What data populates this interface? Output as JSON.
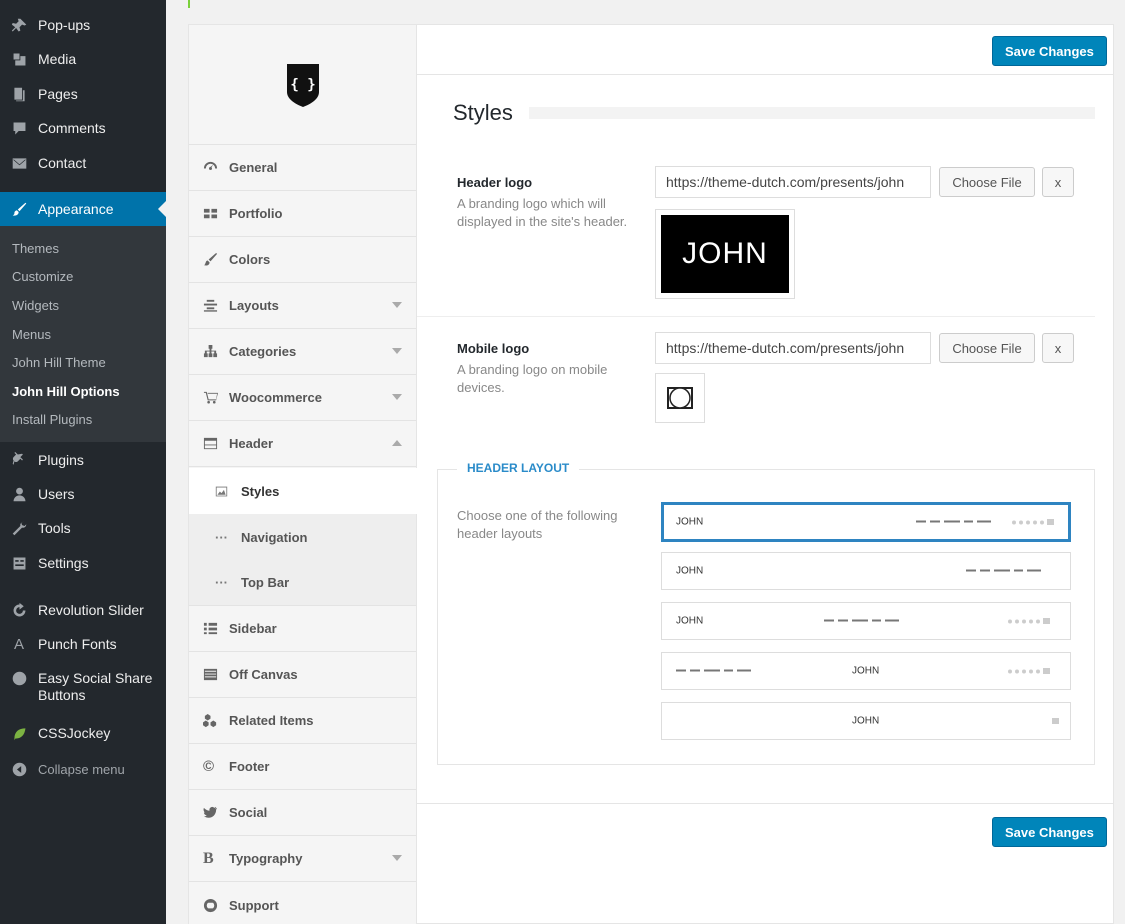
{
  "wp_menu": {
    "items": [
      {
        "label": "Pop-ups",
        "icon": "pin-icon"
      },
      {
        "label": "Media",
        "icon": "media-icon"
      },
      {
        "label": "Pages",
        "icon": "pages-icon"
      },
      {
        "label": "Comments",
        "icon": "comments-icon"
      },
      {
        "label": "Contact",
        "icon": "mail-icon"
      },
      {
        "label": "Appearance",
        "icon": "paintbrush-icon"
      }
    ],
    "appearance_sub": [
      "Themes",
      "Customize",
      "Widgets",
      "Menus",
      "John Hill Theme",
      "John Hill Options",
      "Install Plugins"
    ],
    "items_after": [
      {
        "label": "Plugins",
        "icon": "plug-icon"
      },
      {
        "label": "Users",
        "icon": "users-icon"
      },
      {
        "label": "Tools",
        "icon": "wrench-icon"
      },
      {
        "label": "Settings",
        "icon": "settings-icon"
      },
      {
        "label": "Revolution Slider",
        "icon": "refresh-icon"
      },
      {
        "label": "Punch Fonts",
        "icon": "letter-a-icon"
      },
      {
        "label": "Easy Social Share Buttons",
        "icon": "share-icon"
      },
      {
        "label": "CSSJockey",
        "icon": "leaf-icon"
      }
    ],
    "collapse": "Collapse menu"
  },
  "options_nav": {
    "logo_glyph": "{ }",
    "items": [
      "General",
      "Portfolio",
      "Colors",
      "Layouts",
      "Categories",
      "Woocommerce",
      "Header"
    ],
    "header_sub": [
      "Styles",
      "Navigation",
      "Top Bar"
    ],
    "sub_glyph": "···",
    "items_after": [
      "Sidebar",
      "Off Canvas",
      "Related Items",
      "Footer",
      "Social",
      "Typography",
      "Support"
    ]
  },
  "main": {
    "save_label": "Save Changes",
    "section_title": "Styles",
    "header_logo": {
      "label": "Header logo",
      "desc": "A branding logo which will displayed in the site's header.",
      "url": "https://theme-dutch.com/presents/john",
      "choose": "Choose File",
      "remove": "x",
      "preview_text": "JOHN"
    },
    "mobile_logo": {
      "label": "Mobile logo",
      "desc": "A branding logo on mobile devices.",
      "url": "https://theme-dutch.com/presents/john",
      "choose": "Choose File",
      "remove": "x"
    },
    "header_layout": {
      "legend": "HEADER LAYOUT",
      "desc": "Choose one of the following header layouts",
      "brand": "JOHN",
      "selected_index": 0
    }
  },
  "colors": {
    "wp_sidebar": "#23282d",
    "wp_active": "#0073aa",
    "primary_button": "#0085ba",
    "legend_blue": "#2a8bc9",
    "selected_layout": "#2e84c1"
  }
}
